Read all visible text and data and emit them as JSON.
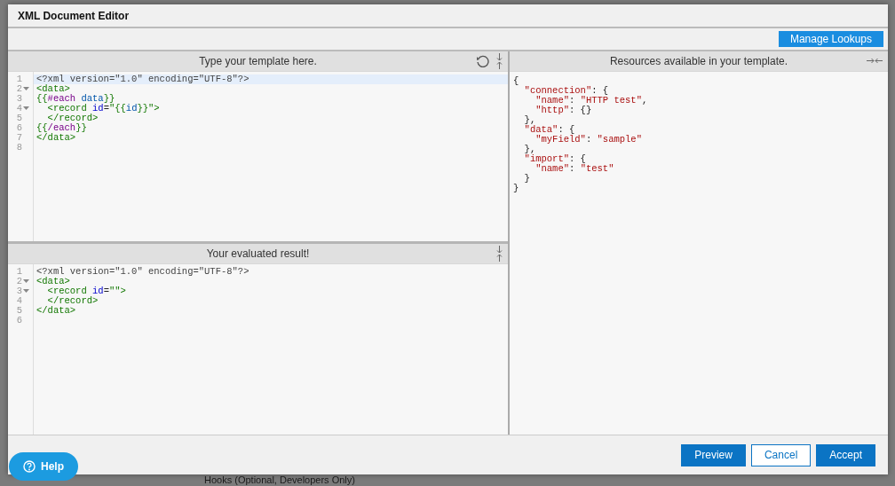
{
  "window": {
    "title": "XML Document Editor"
  },
  "toolbar": {
    "button": "Manage Lookups"
  },
  "template_pane": {
    "header": "Type your template here.",
    "lines": [
      {
        "number": "1",
        "foldable": false,
        "highlighted": true,
        "tokens": [
          {
            "kind": "meta",
            "text": "<?xml version=\"1.0\" encoding=\"UTF-8\"?>"
          }
        ]
      },
      {
        "number": "2",
        "foldable": true,
        "highlighted": false,
        "tokens": [
          {
            "kind": "tag",
            "text": "<data>"
          }
        ]
      },
      {
        "number": "3",
        "foldable": false,
        "highlighted": false,
        "tokens": [
          {
            "kind": "bracket",
            "text": "{{"
          },
          {
            "kind": "keyword",
            "text": "#each"
          },
          {
            "kind": "variable",
            "text": " data"
          },
          {
            "kind": "bracket",
            "text": "}}"
          }
        ]
      },
      {
        "number": "4",
        "foldable": true,
        "highlighted": false,
        "tokens": [
          {
            "kind": "tag",
            "text": "  <record"
          },
          {
            "kind": "attr",
            "text": " id"
          },
          {
            "kind": "plain",
            "text": "="
          },
          {
            "kind": "tag",
            "text": "\"{{"
          },
          {
            "kind": "variable",
            "text": "id"
          },
          {
            "kind": "tag",
            "text": "}}\">"
          }
        ]
      },
      {
        "number": "5",
        "foldable": false,
        "highlighted": false,
        "tokens": [
          {
            "kind": "tag",
            "text": "  </record>"
          }
        ]
      },
      {
        "number": "6",
        "foldable": false,
        "highlighted": false,
        "tokens": [
          {
            "kind": "bracket",
            "text": "{{"
          },
          {
            "kind": "keyword",
            "text": "/each"
          },
          {
            "kind": "bracket",
            "text": "}}"
          }
        ]
      },
      {
        "number": "7",
        "foldable": false,
        "highlighted": false,
        "tokens": [
          {
            "kind": "tag",
            "text": "</data>"
          }
        ]
      },
      {
        "number": "8",
        "foldable": false,
        "highlighted": false
      }
    ]
  },
  "result_pane": {
    "header": "Your evaluated result!",
    "lines": [
      {
        "number": "1",
        "foldable": false,
        "highlighted": false,
        "tokens": [
          {
            "kind": "meta",
            "text": "<?xml version=\"1.0\" encoding=\"UTF-8\"?>"
          }
        ]
      },
      {
        "number": "2",
        "foldable": true,
        "highlighted": false,
        "tokens": [
          {
            "kind": "tag",
            "text": "<data>"
          }
        ]
      },
      {
        "number": "3",
        "foldable": true,
        "highlighted": false,
        "tokens": [
          {
            "kind": "tag",
            "text": "  <record"
          },
          {
            "kind": "attr",
            "text": " id"
          },
          {
            "kind": "plain",
            "text": "="
          },
          {
            "kind": "tag",
            "text": "\"\">"
          }
        ]
      },
      {
        "number": "4",
        "foldable": false,
        "highlighted": false,
        "tokens": [
          {
            "kind": "tag",
            "text": "  </record>"
          }
        ]
      },
      {
        "number": "5",
        "foldable": false,
        "highlighted": false,
        "tokens": [
          {
            "kind": "tag",
            "text": "</data>"
          }
        ]
      },
      {
        "number": "6",
        "foldable": false,
        "highlighted": false
      }
    ]
  },
  "resources_pane": {
    "header": "Resources available in your template.",
    "lines": [
      [
        {
          "kind": "plain",
          "text": "{"
        }
      ],
      [
        {
          "kind": "string",
          "text": "  \"connection\""
        },
        {
          "kind": "plain",
          "text": ": {"
        }
      ],
      [
        {
          "kind": "string",
          "text": "    \"name\""
        },
        {
          "kind": "plain",
          "text": ":"
        },
        {
          "kind": "string",
          "text": " \"HTTP test\""
        },
        {
          "kind": "plain",
          "text": ","
        }
      ],
      [
        {
          "kind": "string",
          "text": "    \"http\""
        },
        {
          "kind": "plain",
          "text": ": {}"
        }
      ],
      [
        {
          "kind": "plain",
          "text": "  },"
        }
      ],
      [
        {
          "kind": "string",
          "text": "  \"data\""
        },
        {
          "kind": "plain",
          "text": ": {"
        }
      ],
      [
        {
          "kind": "string",
          "text": "    \"myField\""
        },
        {
          "kind": "plain",
          "text": ":"
        },
        {
          "kind": "string",
          "text": " \"sample\""
        }
      ],
      [
        {
          "kind": "plain",
          "text": "  },"
        }
      ],
      [
        {
          "kind": "string",
          "text": "  \"import\""
        },
        {
          "kind": "plain",
          "text": ": {"
        }
      ],
      [
        {
          "kind": "string",
          "text": "    \"name\""
        },
        {
          "kind": "plain",
          "text": ":"
        },
        {
          "kind": "string",
          "text": " \"test\""
        }
      ],
      [
        {
          "kind": "plain",
          "text": "  }"
        }
      ],
      [
        {
          "kind": "plain",
          "text": "}"
        }
      ]
    ]
  },
  "footer": {
    "buttons": [
      {
        "label": "Preview",
        "kind": "primary"
      },
      {
        "label": "Cancel",
        "kind": "outline"
      },
      {
        "label": "Accept",
        "kind": "primary"
      }
    ]
  },
  "help_button": {
    "label": "Help"
  },
  "background_text": "Hooks (Optional, Developers Only)"
}
